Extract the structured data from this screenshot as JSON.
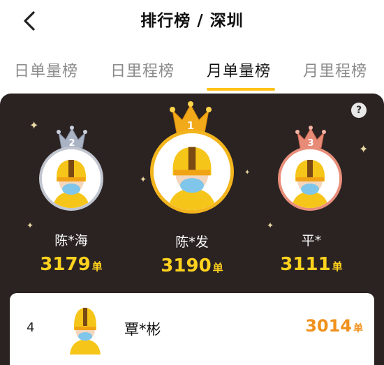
{
  "header": {
    "title": "排行榜 / 深圳",
    "back_icon": "chevron-left-icon"
  },
  "tabs": [
    {
      "label": "日单量榜",
      "active": false
    },
    {
      "label": "日里程榜",
      "active": false
    },
    {
      "label": "月单量榜",
      "active": true
    },
    {
      "label": "月里程榜",
      "active": false
    }
  ],
  "help_icon": "question-icon",
  "help_label": "?",
  "podium": [
    {
      "rank": "2",
      "name": "陈*海",
      "value": "3179",
      "unit": "单",
      "crown_color": "#a9b3c4"
    },
    {
      "rank": "1",
      "name": "陈*发",
      "value": "3190",
      "unit": "单",
      "crown_color": "#f2a91a"
    },
    {
      "rank": "3",
      "name": "平*",
      "value": "3111",
      "unit": "单",
      "crown_color": "#e78a76"
    }
  ],
  "list": [
    {
      "rank": "4",
      "name": "覃*彬",
      "value": "3014",
      "unit": "单"
    }
  ],
  "colors": {
    "accent": "#ffc21a",
    "board": "#2b2322",
    "score": "#ffd21e",
    "list_score": "#f0901c"
  }
}
